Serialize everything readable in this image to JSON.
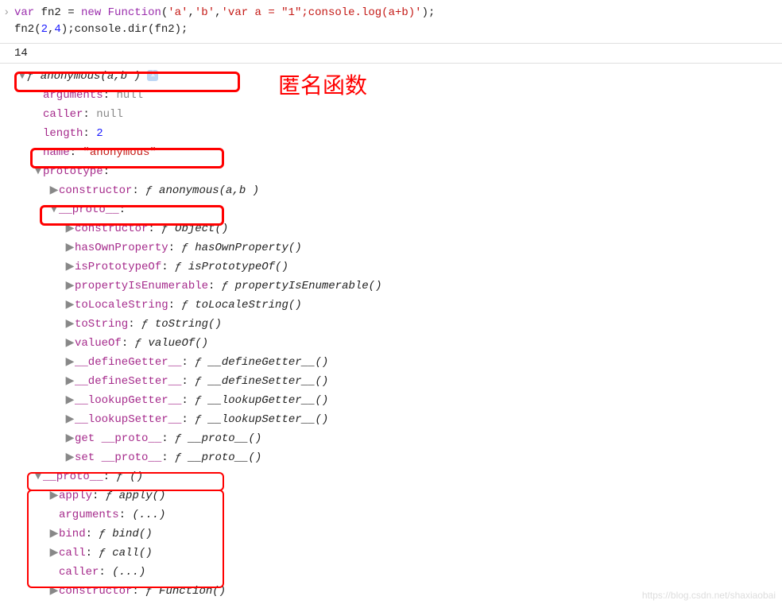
{
  "code": {
    "kw_var": "var",
    "v1": " fn2 = ",
    "kw_new": "new",
    "v2": " ",
    "cls": "Function",
    "p1": "(",
    "s1": "'a'",
    "c1": ",",
    "s2": "'b'",
    "c2": ",",
    "s3": "'var a = \"1\";console.log(a+b)'",
    "p2": ");",
    "line2a": "fn2(",
    "n1": "2",
    "c3": ",",
    "n2": "4",
    "line2b": ");console.dir(fn2);"
  },
  "output": "14",
  "annotation": "匿名函数",
  "header": {
    "f": "ƒ",
    "sig": " anonymous(a,b )"
  },
  "props": {
    "arguments": {
      "k": "arguments",
      "v": "null"
    },
    "caller": {
      "k": "caller",
      "v": "null"
    },
    "length": {
      "k": "length",
      "v": "2"
    },
    "name": {
      "k": "name",
      "v": "\"anonymous\""
    }
  },
  "prototype": {
    "k": "prototype",
    "constructor": {
      "k": "constructor",
      "f": "ƒ",
      "v": " anonymous(a,b )"
    },
    "proto": {
      "k": "__proto__",
      "items": [
        {
          "k": "constructor",
          "f": "ƒ",
          "v": " Object()"
        },
        {
          "k": "hasOwnProperty",
          "f": "ƒ",
          "v": " hasOwnProperty()"
        },
        {
          "k": "isPrototypeOf",
          "f": "ƒ",
          "v": " isPrototypeOf()"
        },
        {
          "k": "propertyIsEnumerable",
          "f": "ƒ",
          "v": " propertyIsEnumerable()"
        },
        {
          "k": "toLocaleString",
          "f": "ƒ",
          "v": " toLocaleString()"
        },
        {
          "k": "toString",
          "f": "ƒ",
          "v": " toString()"
        },
        {
          "k": "valueOf",
          "f": "ƒ",
          "v": " valueOf()"
        },
        {
          "k": "__defineGetter__",
          "f": "ƒ",
          "v": " __defineGetter__()"
        },
        {
          "k": "__defineSetter__",
          "f": "ƒ",
          "v": " __defineSetter__()"
        },
        {
          "k": "__lookupGetter__",
          "f": "ƒ",
          "v": " __lookupGetter__()"
        },
        {
          "k": "__lookupSetter__",
          "f": "ƒ",
          "v": " __lookupSetter__()"
        },
        {
          "k": "get __proto__",
          "f": "ƒ",
          "v": " __proto__()"
        },
        {
          "k": "set __proto__",
          "f": "ƒ",
          "v": " __proto__()"
        }
      ]
    }
  },
  "proto2": {
    "k": "__proto__",
    "f": "ƒ",
    "sig": " ()",
    "items": [
      {
        "k": "apply",
        "f": "ƒ",
        "v": " apply()",
        "arrow": true
      },
      {
        "k": "arguments",
        "v": "(...)",
        "arrow": false
      },
      {
        "k": "bind",
        "f": "ƒ",
        "v": " bind()",
        "arrow": true
      },
      {
        "k": "call",
        "f": "ƒ",
        "v": " call()",
        "arrow": true
      },
      {
        "k": "caller",
        "v": "(...)",
        "arrow": false
      },
      {
        "k": "constructor",
        "f": "ƒ",
        "v": " Function()",
        "arrow": true
      }
    ]
  },
  "watermark": "https://blog.csdn.net/shaxiaobai"
}
